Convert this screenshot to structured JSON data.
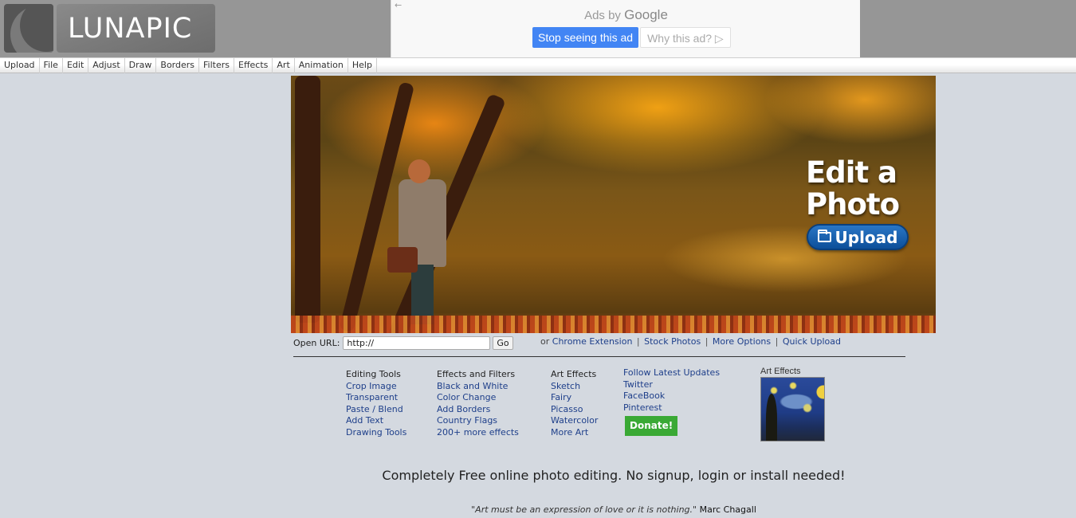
{
  "header": {
    "logo_text": "LUNAPIC",
    "background": "#969696"
  },
  "ad": {
    "back_glyph": "←",
    "ads_by": "Ads by",
    "google": "Google",
    "stop_label": "Stop seeing this ad",
    "why_label": "Why this ad? ▷",
    "stop_color": "#4285f4"
  },
  "menu": {
    "items": [
      "Upload",
      "File",
      "Edit",
      "Adjust",
      "Draw",
      "Borders",
      "Filters",
      "Effects",
      "Art",
      "Animation",
      "Help"
    ]
  },
  "hero": {
    "title_line1": "Edit a",
    "title_line2": "Photo",
    "upload_label": "Upload",
    "upload_icon": "folder-icon"
  },
  "open_url": {
    "label": "Open URL:",
    "value": "http://",
    "go_label": "Go",
    "or_text": "or",
    "links": [
      "Chrome Extension",
      "Stock Photos",
      "More Options",
      "Quick Upload"
    ],
    "separator": "|"
  },
  "columns": [
    {
      "heading": "Editing Tools",
      "links": [
        "Crop Image",
        "Transparent",
        "Paste / Blend",
        "Add Text",
        "Drawing Tools"
      ]
    },
    {
      "heading": "Effects and Filters",
      "links": [
        "Black and White",
        "Color Change",
        "Add Borders",
        "Country Flags",
        "200+ more effects"
      ]
    },
    {
      "heading": "Art Effects",
      "links": [
        "Sketch",
        "Fairy",
        "Picasso",
        "Watercolor",
        "More Art"
      ]
    },
    {
      "links": [
        "Follow Latest Updates",
        "Twitter",
        "FaceBook",
        "Pinterest"
      ],
      "donate_label": "Donate!",
      "donate_color": "#3aa935"
    }
  ],
  "art_preview": {
    "label": "Art Effects"
  },
  "footer": {
    "tagline": "Completely Free online photo editing. No signup, login or install needed!",
    "quote": "\"Art must be an expression of love or it is nothing.\"",
    "author": "Marc Chagall"
  },
  "colors": {
    "link": "#1e3f8a",
    "page_bg": "#d4d9e0",
    "upload_button": "#0d4f9a"
  }
}
